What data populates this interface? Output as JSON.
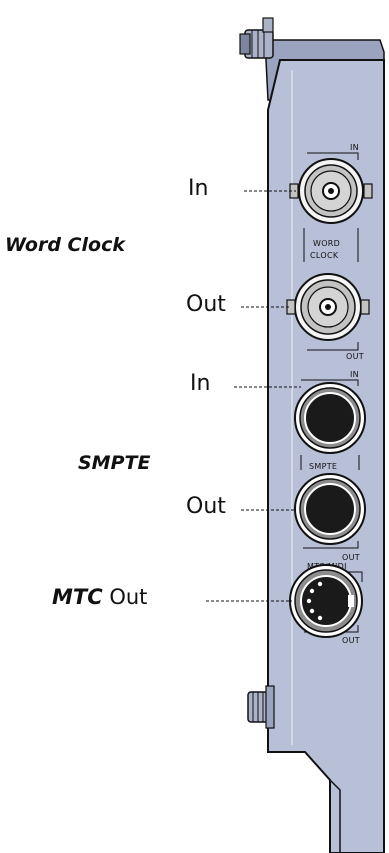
{
  "labels": {
    "wc_in": "In",
    "word_clock": "Word Clock",
    "wc_out": "Out",
    "smpte_in": "In",
    "smpte": "SMPTE",
    "smpte_out": "Out",
    "mtc_bold": "MTC",
    "mtc_out": "Out"
  },
  "bracket_labels": {
    "wc_in": "IN",
    "word_1": "WORD",
    "word_2": "CLOCK",
    "wc_out": "OUT",
    "smpte_in": "IN",
    "smpte": "SMPTE",
    "smpte_out": "OUT",
    "mtc_midi": "MTC/MIDI",
    "mtc_out": "OUT"
  },
  "colors": {
    "bracket_fill": "#b7c0d6",
    "bracket_shade": "#9aa4bf",
    "outline": "#111111",
    "bnc_body": "#c3c3c3",
    "jack_ring": "#8c8c8c",
    "jack_hole": "#1a1a1a"
  }
}
